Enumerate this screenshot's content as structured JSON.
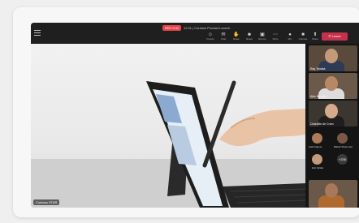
{
  "meeting": {
    "recording_badge": "REC 0:42",
    "title": "12:31 | Contoso Product Launch"
  },
  "toolbar": [
    {
      "label": "People",
      "icon": "people-icon",
      "glyph": "☺"
    },
    {
      "label": "Chat",
      "icon": "chat-icon",
      "glyph": "✉"
    },
    {
      "label": "Raise",
      "icon": "raise-hand-icon",
      "glyph": "✋"
    },
    {
      "label": "React",
      "icon": "react-icon",
      "glyph": "☻"
    },
    {
      "label": "Rooms",
      "icon": "rooms-icon",
      "glyph": "▣"
    },
    {
      "label": "More",
      "icon": "more-icon",
      "glyph": "⋯"
    },
    {
      "label": "Mic",
      "icon": "mic-icon",
      "glyph": "●"
    },
    {
      "label": "Camera",
      "icon": "camera-icon",
      "glyph": "■"
    },
    {
      "label": "Share",
      "icon": "share-icon",
      "glyph": "⬆"
    }
  ],
  "leave_label": "Leave",
  "stage": {
    "presenter_label": "Contoso STAR"
  },
  "participants": [
    {
      "name": "Ray Tanaka"
    },
    {
      "name": "Alex Nguyen"
    },
    {
      "name": "Charlotte de Crum"
    }
  ],
  "small_participants": [
    {
      "name": "Aadi Kapoor"
    },
    {
      "name": "Babak Shammas"
    },
    {
      "name": "Eric Ishida"
    }
  ],
  "more_count": "+236"
}
